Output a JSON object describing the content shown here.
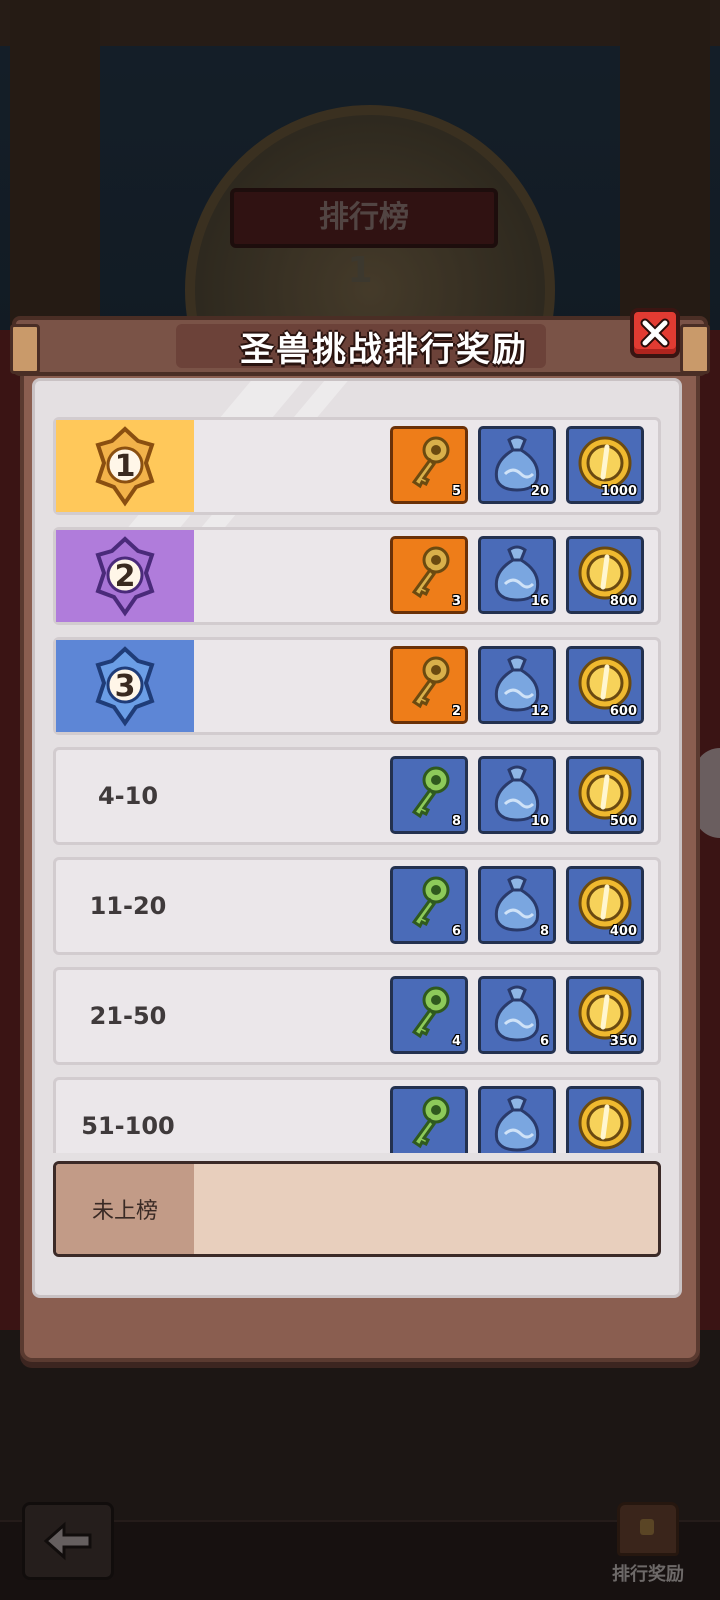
{
  "background": {
    "board_title": "排行榜",
    "board_rank": "1",
    "rank_reward_label": "排行奖励"
  },
  "dialog": {
    "title": "圣兽挑战排行奖励"
  },
  "ranks": [
    {
      "rank": "1",
      "badge_color": "#ffc85a",
      "rewards": [
        {
          "icon": "gold-key-icon",
          "count": "5"
        },
        {
          "icon": "pouch-icon",
          "count": "20"
        },
        {
          "icon": "coin-icon",
          "count": "1000"
        }
      ]
    },
    {
      "rank": "2",
      "badge_color": "#b07cdb",
      "rewards": [
        {
          "icon": "gold-key-icon",
          "count": "3"
        },
        {
          "icon": "pouch-icon",
          "count": "16"
        },
        {
          "icon": "coin-icon",
          "count": "800"
        }
      ]
    },
    {
      "rank": "3",
      "badge_color": "#5d86d6",
      "rewards": [
        {
          "icon": "gold-key-icon",
          "count": "2"
        },
        {
          "icon": "pouch-icon",
          "count": "12"
        },
        {
          "icon": "coin-icon",
          "count": "600"
        }
      ]
    },
    {
      "range": "4-10",
      "rewards": [
        {
          "icon": "green-key-icon",
          "count": "8"
        },
        {
          "icon": "pouch-icon",
          "count": "10"
        },
        {
          "icon": "coin-icon",
          "count": "500"
        }
      ]
    },
    {
      "range": "11-20",
      "rewards": [
        {
          "icon": "green-key-icon",
          "count": "6"
        },
        {
          "icon": "pouch-icon",
          "count": "8"
        },
        {
          "icon": "coin-icon",
          "count": "400"
        }
      ]
    },
    {
      "range": "21-50",
      "rewards": [
        {
          "icon": "green-key-icon",
          "count": "4"
        },
        {
          "icon": "pouch-icon",
          "count": "6"
        },
        {
          "icon": "coin-icon",
          "count": "350"
        }
      ]
    },
    {
      "range": "51-100",
      "rewards": [
        {
          "icon": "green-key-icon",
          "count": ""
        },
        {
          "icon": "pouch-icon",
          "count": ""
        },
        {
          "icon": "coin-icon",
          "count": ""
        }
      ]
    }
  ],
  "unranked": {
    "label": "未上榜"
  }
}
